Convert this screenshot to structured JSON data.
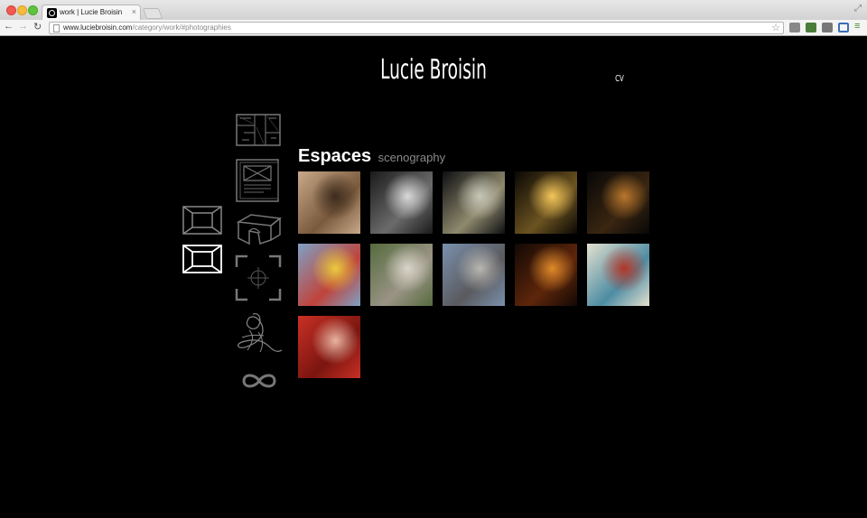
{
  "browser": {
    "tab_title": "work | Lucie Broisin",
    "tab_close": "×",
    "url_host": "www.luciebroisin.com",
    "url_path": "/category/work/#photographies",
    "back": "←",
    "forward": "→",
    "reload": "↻",
    "star": "☆",
    "menu": "≡",
    "fullscreen": "⤢"
  },
  "site": {
    "title": "Lucie Broisin",
    "cv_label": "CV"
  },
  "nav_icons": [
    "floorplan-icon",
    "layout-icon",
    "frame-icon",
    "frame-selected-icon",
    "box-icon",
    "crosshair-icon",
    "sketch-icon",
    "infinity-icon"
  ],
  "section": {
    "title": "Espaces",
    "subtitle": "scenography"
  },
  "gallery": {
    "items": [
      {
        "name": "thumb-1",
        "colors": [
          "#c9a98a",
          "#7a5a3c",
          "#3d2b1d"
        ]
      },
      {
        "name": "thumb-2",
        "colors": [
          "#1a1a1a",
          "#6b6b6b",
          "#d9d9d9"
        ]
      },
      {
        "name": "thumb-3",
        "colors": [
          "#0e0f12",
          "#8f8a6e",
          "#c8c7b8"
        ]
      },
      {
        "name": "thumb-4",
        "colors": [
          "#0a0804",
          "#6c5321",
          "#f3c65a"
        ]
      },
      {
        "name": "thumb-5",
        "colors": [
          "#070707",
          "#3a2611",
          "#b9772d"
        ]
      },
      {
        "name": "thumb-6",
        "colors": [
          "#7ea1c5",
          "#c0433b",
          "#eacb3c"
        ]
      },
      {
        "name": "thumb-7",
        "colors": [
          "#556b3d",
          "#9a9486",
          "#d9d5c9"
        ]
      },
      {
        "name": "thumb-8",
        "colors": [
          "#7a90ad",
          "#5a5a5e",
          "#b8b6b0"
        ]
      },
      {
        "name": "thumb-9",
        "colors": [
          "#120804",
          "#5e260b",
          "#e08a2a"
        ]
      },
      {
        "name": "thumb-10",
        "colors": [
          "#e4e1cf",
          "#4d8ca3",
          "#b23628"
        ]
      },
      {
        "name": "thumb-11",
        "colors": [
          "#c93025",
          "#7b1510",
          "#e9b4a0"
        ]
      }
    ]
  }
}
